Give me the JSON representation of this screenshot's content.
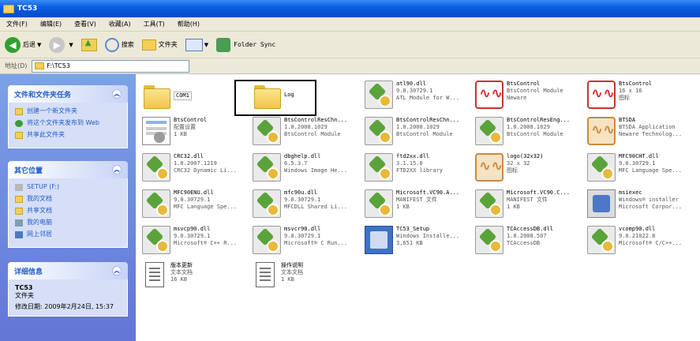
{
  "window": {
    "title": "TC53"
  },
  "menu": [
    "文件(F)",
    "编辑(E)",
    "查看(V)",
    "收藏(A)",
    "工具(T)",
    "帮助(H)"
  ],
  "toolbar": {
    "back": "后退",
    "search": "搜索",
    "folders": "文件夹",
    "folder_sync": "Folder Sync"
  },
  "address": {
    "label": "地址(D)",
    "path": "F:\\TC53"
  },
  "sidebar": {
    "tasks": {
      "title": "文件和文件夹任务",
      "items": [
        "创建一个新文件夹",
        "将这个文件夹发布到 Web",
        "共享此文件夹"
      ]
    },
    "places": {
      "title": "其它位置",
      "items": [
        "SETUP (F:)",
        "我的文档",
        "共享文档",
        "我的电脑",
        "网上邻居"
      ]
    },
    "details": {
      "title": "详细信息",
      "name": "TC53",
      "type": "文件夹",
      "modified": "修改日期: 2009年2月24日, 15:37"
    }
  },
  "files": [
    {
      "name": "COM1",
      "line2": "",
      "line3": ""
    },
    {
      "name": "Log",
      "line2": "",
      "line3": ""
    },
    {
      "name": "atl90.dll",
      "line2": "9.0.30729.1",
      "line3": "ATL Module for W..."
    },
    {
      "name": "BtsControl",
      "line2": "BtsControl Module",
      "line3": "Neware"
    },
    {
      "name": "BtsControl",
      "line2": "16 x 16",
      "line3": "图标"
    },
    {
      "name": "BtsControl",
      "line2": "配置设置",
      "line3": "1 KB"
    },
    {
      "name": "BtsControlResChn...",
      "line2": "1.0.2008.1029",
      "line3": "BtsControl Module"
    },
    {
      "name": "BtsControlResChn...",
      "line2": "1.0.2008.1029",
      "line3": "BtsControl Module"
    },
    {
      "name": "BtsControlResEng...",
      "line2": "1.0.2008.1029",
      "line3": "BtsControl Module"
    },
    {
      "name": "BTSDA",
      "line2": "BTSDA Application",
      "line3": "Neware Technolog..."
    },
    {
      "name": "CRC32.dll",
      "line2": "1.0.2007.1219",
      "line3": "CRC32 Dynamic Li..."
    },
    {
      "name": "dbghelp.dll",
      "line2": "6.5.3.7",
      "line3": "Windows Image He..."
    },
    {
      "name": "ftd2xx.dll",
      "line2": "3.1.15.0",
      "line3": "FTD2XX library"
    },
    {
      "name": "logo(32x32)",
      "line2": "32 x 32",
      "line3": "图标"
    },
    {
      "name": "MFC90CHT.dll",
      "line2": "9.0.30729.1",
      "line3": "MFC Language Spe..."
    },
    {
      "name": "MFC90ENU.dll",
      "line2": "9.0.30729.1",
      "line3": "MFC Language Spe..."
    },
    {
      "name": "mfc90u.dll",
      "line2": "9.0.30729.1",
      "line3": "MFCDLL Shared Li..."
    },
    {
      "name": "Microsoft.VC90.A...",
      "line2": "MANIFEST 文件",
      "line3": "1 KB"
    },
    {
      "name": "Microsoft.VC90.C...",
      "line2": "MANIFEST 文件",
      "line3": "1 KB"
    },
    {
      "name": "msiexec",
      "line2": "Windows® installer",
      "line3": "Microsoft Corpor..."
    },
    {
      "name": "msvcp90.dll",
      "line2": "9.0.30729.1",
      "line3": "Microsoft® C++ R..."
    },
    {
      "name": "msvcr90.dll",
      "line2": "9.0.30729.1",
      "line3": "Microsoft® C Run..."
    },
    {
      "name": "TC53_Setup",
      "line2": "Windows Installe...",
      "line3": "3,651 KB"
    },
    {
      "name": "TCAccessDB.dll",
      "line2": "1.0.2008.507",
      "line3": "TCAccessDB"
    },
    {
      "name": "vcomp90.dll",
      "line2": "9.0.21022.8",
      "line3": "Microsoft® C/C++..."
    },
    {
      "name": "版本更新",
      "line2": "文本文档",
      "line3": "16 KB"
    },
    {
      "name": "操作说明",
      "line2": "文本文档",
      "line3": "1 KB"
    }
  ]
}
